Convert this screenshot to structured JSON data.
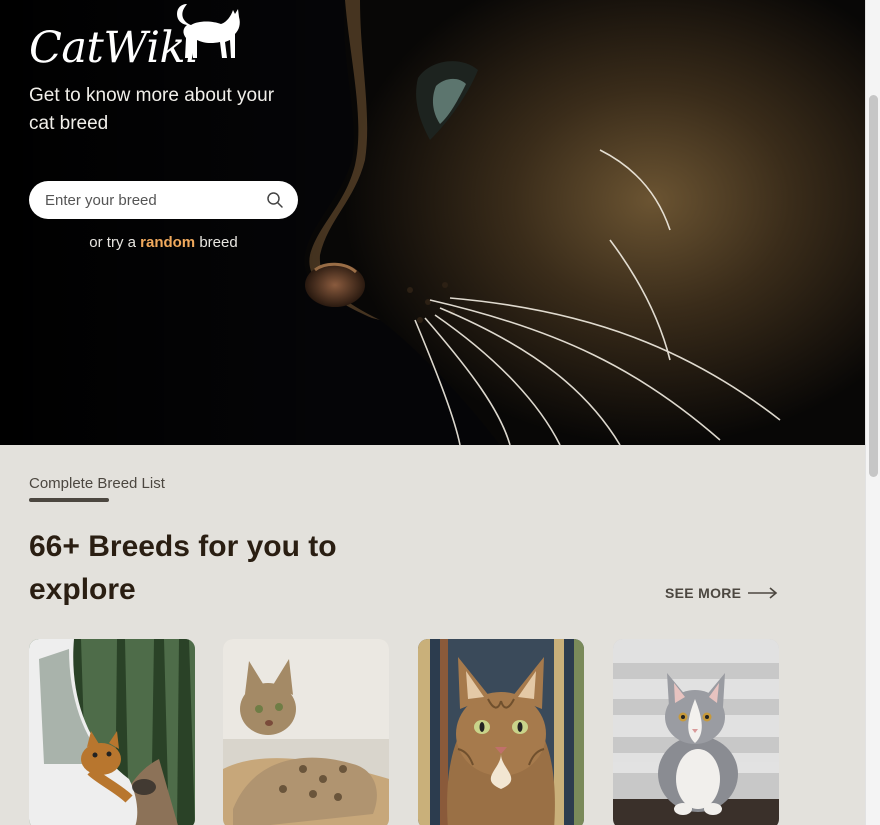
{
  "brand": {
    "name": "CatWiki",
    "cat_logo_icon": "cat-silhouette-icon"
  },
  "hero": {
    "tagline": "Get to know more about your cat breed",
    "search": {
      "placeholder": "Enter your breed",
      "value": "",
      "icon": "search-icon"
    },
    "random": {
      "prefix": "or try a ",
      "link": "random",
      "suffix": " breed"
    }
  },
  "breeds_section": {
    "eyebrow": "Complete Breed List",
    "headline": "66+ Breeds for you to explore",
    "see_more": "SEE MORE",
    "see_more_icon": "arrow-right-icon",
    "cards": [
      {
        "image": "bengal-cat-in-car-window"
      },
      {
        "image": "savannah-cat-lying-down"
      },
      {
        "image": "maine-coon-tabby-portrait"
      },
      {
        "image": "grey-white-curly-kitten"
      }
    ]
  },
  "colors": {
    "hero_bg": "#060608",
    "section_bg": "#e3e1dc",
    "accent": "#f0a95d",
    "heading": "#2a1e12",
    "muted": "#4c4740"
  }
}
